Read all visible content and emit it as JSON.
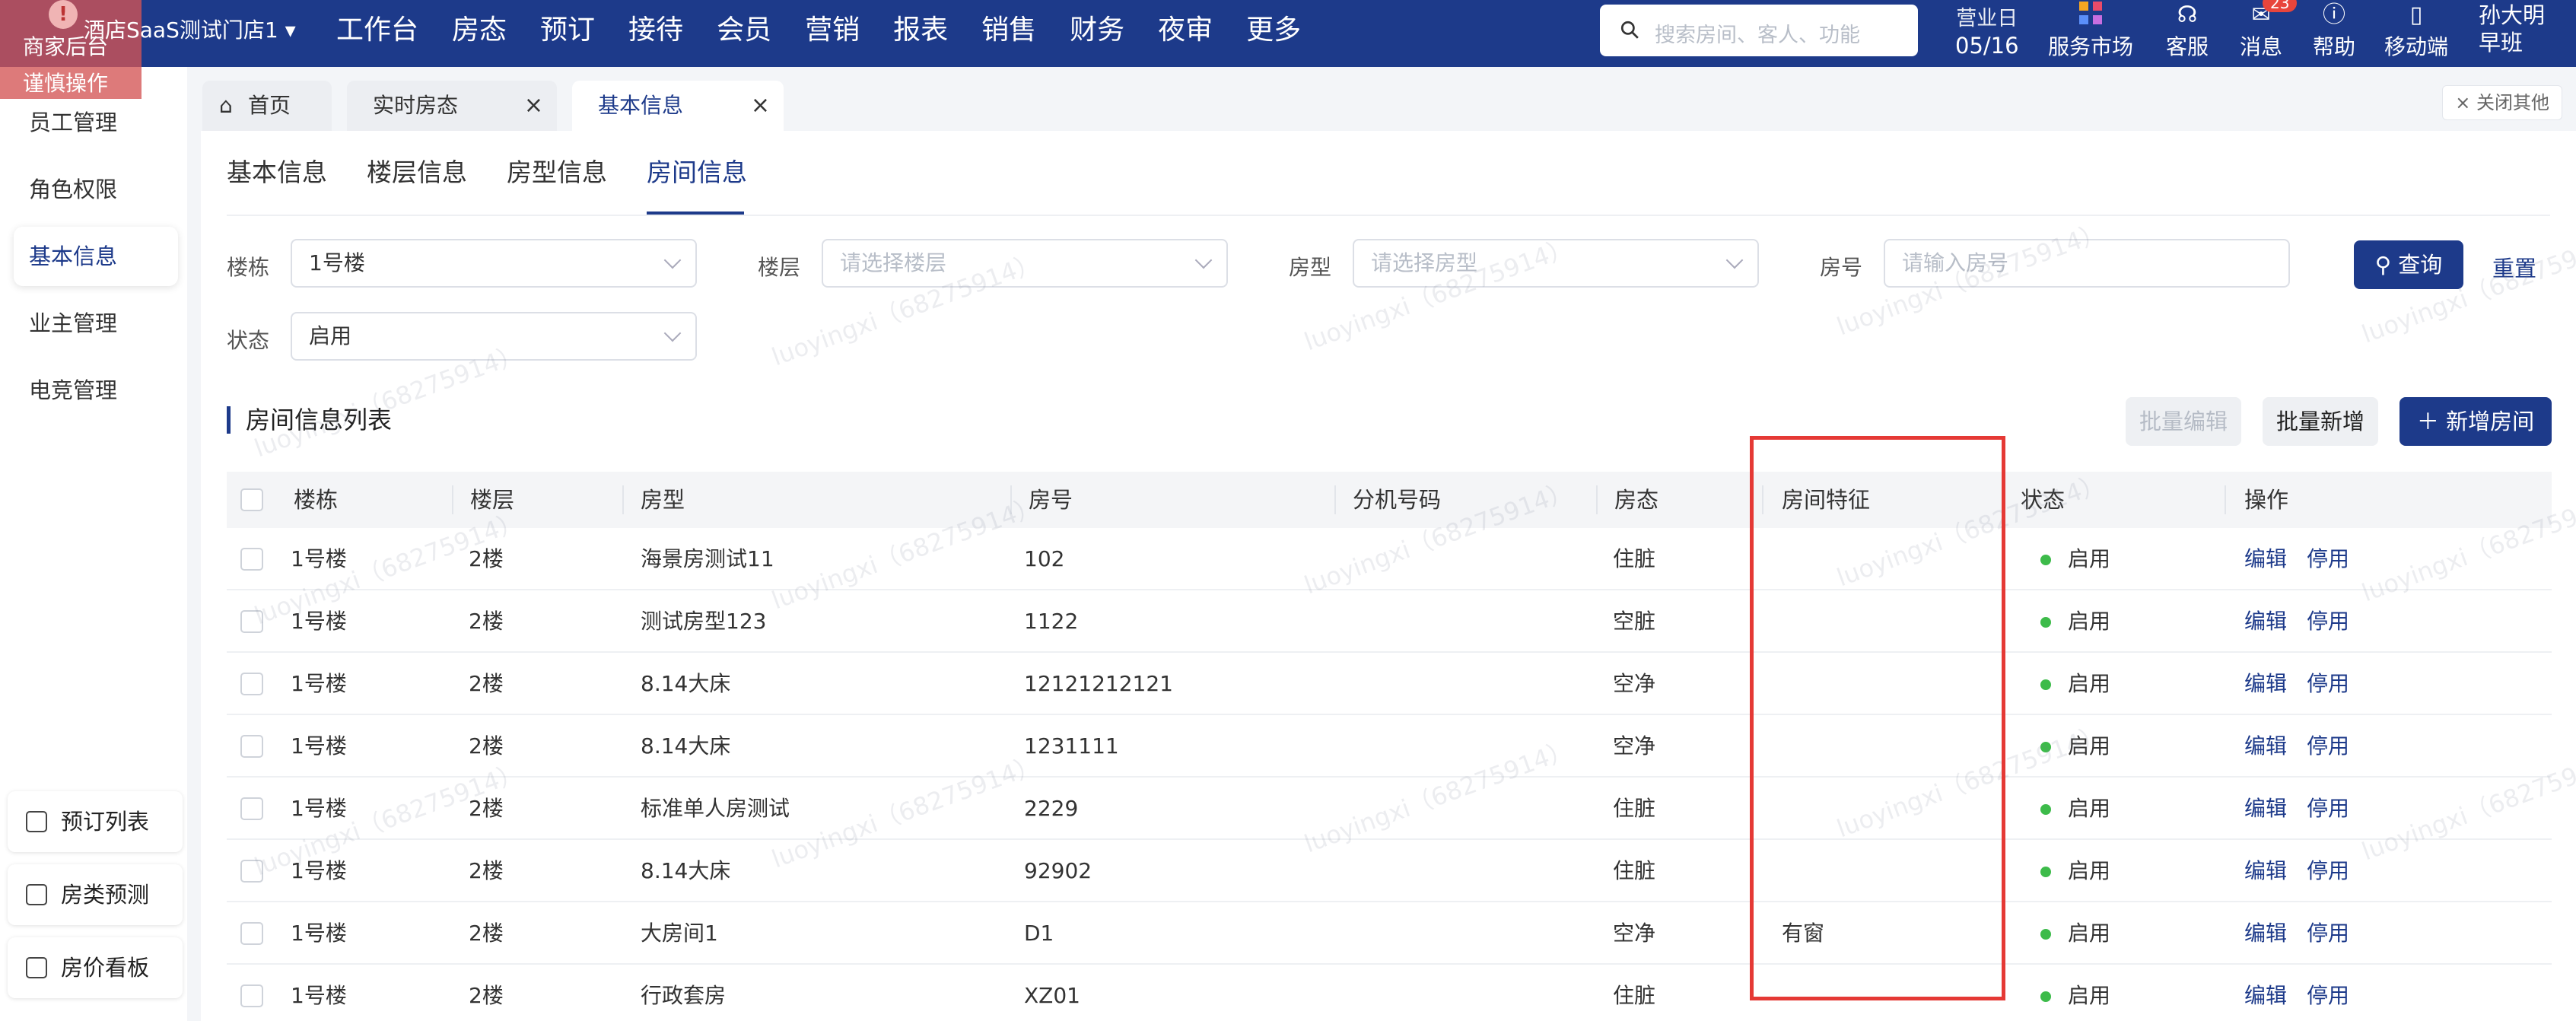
{
  "topbar": {
    "merchant_label": "商家后台",
    "warning_label": "谨慎操作",
    "store_name": "酒店SaaS测试门店1",
    "nav": [
      "工作台",
      "房态",
      "预订",
      "接待",
      "会员",
      "营销",
      "报表",
      "销售",
      "财务",
      "夜审",
      "更多"
    ],
    "search_placeholder": "搜索房间、客人、功能",
    "business_day_label": "营业日",
    "business_day": "05/16",
    "tools": [
      {
        "label": "服务市场",
        "icon": "apps-icon"
      },
      {
        "label": "客服",
        "icon": "headset-icon"
      },
      {
        "label": "消息",
        "icon": "message-icon",
        "badge": "23"
      },
      {
        "label": "帮助",
        "icon": "help-icon"
      },
      {
        "label": "移动端",
        "icon": "mobile-icon"
      }
    ],
    "user_name": "孙大明",
    "user_shift": "早班"
  },
  "sidebar": {
    "items": [
      "员工管理",
      "角色权限",
      "基本信息",
      "业主管理",
      "电竞管理"
    ],
    "active_index": 2,
    "quick": [
      "预订列表",
      "房类预测",
      "房价看板"
    ]
  },
  "tabs": {
    "items": [
      "首页",
      "实时房态",
      "基本信息"
    ],
    "active_index": 2,
    "close_all": "× 关闭其他"
  },
  "subtabs": {
    "items": [
      "基本信息",
      "楼层信息",
      "房型信息",
      "房间信息"
    ],
    "active_index": 3
  },
  "filters": {
    "building_label": "楼栋",
    "building_value": "1号楼",
    "floor_label": "楼层",
    "floor_placeholder": "请选择楼层",
    "roomtype_label": "房型",
    "roomtype_placeholder": "请选择房型",
    "roomno_label": "房号",
    "roomno_placeholder": "请输入房号",
    "status_label": "状态",
    "status_value": "启用",
    "query_button": "查询",
    "reset_button": "重置"
  },
  "list": {
    "title": "房间信息列表",
    "batch_edit": "批量编辑",
    "batch_add": "批量新增",
    "add_room": "新增房间"
  },
  "table": {
    "columns": [
      "楼栋",
      "楼层",
      "房型",
      "房号",
      "分机号码",
      "房态",
      "房间特征",
      "状态",
      "操作"
    ],
    "rows": [
      {
        "building": "1号楼",
        "floor": "2楼",
        "type": "海景房测试11",
        "no": "102",
        "ext": "",
        "state": "住脏",
        "feature": "",
        "status": "启用"
      },
      {
        "building": "1号楼",
        "floor": "2楼",
        "type": "测试房型123",
        "no": "1122",
        "ext": "",
        "state": "空脏",
        "feature": "",
        "status": "启用"
      },
      {
        "building": "1号楼",
        "floor": "2楼",
        "type": "8.14大床",
        "no": "12121212121",
        "ext": "",
        "state": "空净",
        "feature": "",
        "status": "启用"
      },
      {
        "building": "1号楼",
        "floor": "2楼",
        "type": "8.14大床",
        "no": "1231111",
        "ext": "",
        "state": "空净",
        "feature": "",
        "status": "启用"
      },
      {
        "building": "1号楼",
        "floor": "2楼",
        "type": "标准单人房测试",
        "no": "2229",
        "ext": "",
        "state": "住脏",
        "feature": "",
        "status": "启用"
      },
      {
        "building": "1号楼",
        "floor": "2楼",
        "type": "8.14大床",
        "no": "92902",
        "ext": "",
        "state": "住脏",
        "feature": "",
        "status": "启用"
      },
      {
        "building": "1号楼",
        "floor": "2楼",
        "type": "大房间1",
        "no": "D1",
        "ext": "",
        "state": "空净",
        "feature": "有窗",
        "status": "启用"
      },
      {
        "building": "1号楼",
        "floor": "2楼",
        "type": "行政套房",
        "no": "XZ01",
        "ext": "",
        "state": "住脏",
        "feature": "",
        "status": "启用"
      }
    ],
    "edit_label": "编辑",
    "disable_label": "停用"
  },
  "watermark": "luoyingxi（68275914）",
  "colors": {
    "brand": "#1d3a8a",
    "status_ok": "#3dbb4a",
    "highlight": "#e53935"
  }
}
